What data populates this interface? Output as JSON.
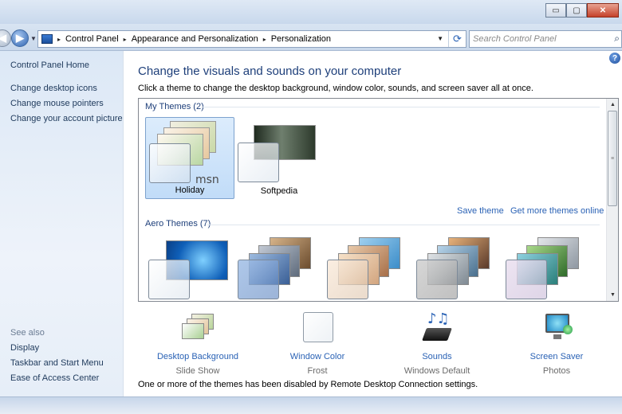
{
  "window": {
    "min_label": "▭",
    "max_label": "▢",
    "close_label": "✕"
  },
  "nav": {
    "back_icon": "◀",
    "forward_icon": "▶",
    "dropdown_icon": "▼",
    "breadcrumbs": [
      "Control Panel",
      "Appearance and Personalization",
      "Personalization"
    ],
    "separator": "▸",
    "refresh_icon": "⟳",
    "search_placeholder": "Search Control Panel",
    "search_icon": "⌕"
  },
  "sidebar": {
    "home": "Control Panel Home",
    "tasks": [
      "Change desktop icons",
      "Change mouse pointers",
      "Change your account picture"
    ],
    "see_also_label": "See also",
    "see_also": [
      "Display",
      "Taskbar and Start Menu",
      "Ease of Access Center"
    ]
  },
  "main": {
    "help_icon": "?",
    "heading": "Change the visuals and sounds on your computer",
    "subtext": "Click a theme to change the desktop background, window color, sounds, and screen saver all at once.",
    "my_themes_label": "My Themes (2)",
    "my_themes": [
      {
        "name": "Holiday",
        "selected": true,
        "brand": "msn"
      },
      {
        "name": "Softpedia",
        "selected": false
      }
    ],
    "save_theme": "Save theme",
    "get_more": "Get more themes online",
    "aero_themes_label": "Aero Themes (7)",
    "scroll_up": "▲",
    "scroll_down": "▼",
    "scroll_grip": "≡",
    "bottom_items": [
      {
        "label": "Desktop Background",
        "sub": "Slide Show",
        "icon": "desktop-background-icon"
      },
      {
        "label": "Window Color",
        "sub": "Frost",
        "icon": "window-color-icon"
      },
      {
        "label": "Sounds",
        "sub": "Windows Default",
        "icon": "sounds-icon"
      },
      {
        "label": "Screen Saver",
        "sub": "Photos",
        "icon": "screen-saver-icon"
      }
    ],
    "notice": "One or more of the themes has been disabled by Remote Desktop Connection settings."
  },
  "colors": {
    "link": "#2a62b5",
    "heading": "#1e3f7a",
    "selection": "#c1dcf8"
  }
}
